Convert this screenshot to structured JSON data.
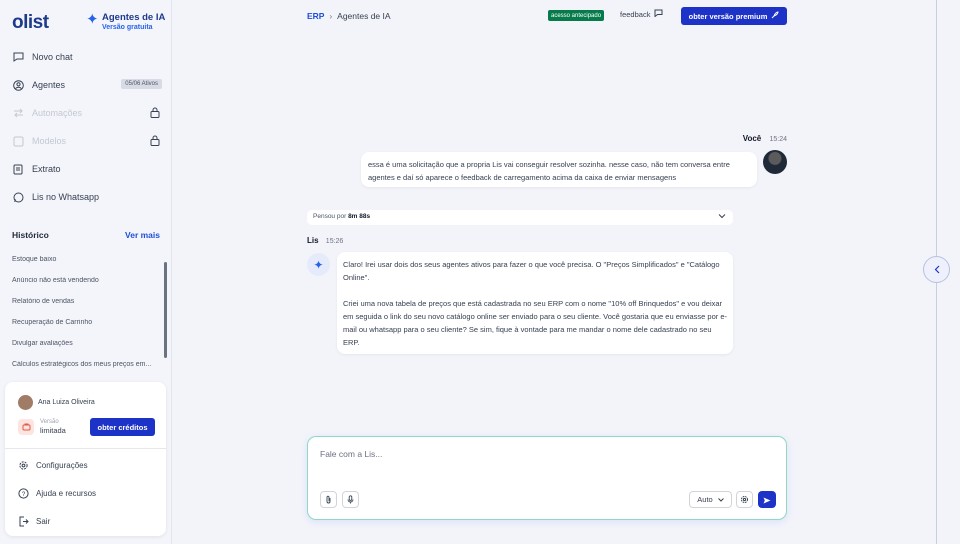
{
  "brand": {
    "logo": "olist",
    "agents_title": "Agentes de IA",
    "agents_subtitle": "Versão gratuita"
  },
  "nav": {
    "new_chat": "Novo chat",
    "agents": "Agentes",
    "agents_badge": "05/06 Ativos",
    "automations": "Automações",
    "models": "Modelos",
    "statement": "Extrato",
    "whatsapp": "Lis no Whatsapp"
  },
  "history": {
    "title": "Histórico",
    "see_more": "Ver mais",
    "items": [
      "Estoque baixo",
      "Anúncio não está vendendo",
      "Relatório de vendas",
      "Recuperação de Carrinho",
      "Divulgar avaliações",
      "Cálculos estratégicos dos meus preços em..."
    ]
  },
  "user_card": {
    "name": "Ana Luiza Oliveira",
    "version_label": "Versão",
    "version_value": "limitada",
    "credits_button": "obter créditos",
    "settings": "Configurações",
    "help": "Ajuda e recursos",
    "logout": "Sair"
  },
  "topbar": {
    "crumb_root": "ERP",
    "crumb_current": "Agentes de IA",
    "early_access": "acesso antecipado",
    "feedback": "feedback",
    "premium_button": "obter versão premium"
  },
  "messages": {
    "user_name": "Você",
    "user_time": "15:24",
    "user_text": "essa é uma solicitação que a propria Lis vai conseguir resolver sozinha. nesse caso, não tem conversa entre agentes e daí só aparece o feedback de carregamento acima da caixa de enviar mensagens",
    "thought_label": "Pensou por",
    "thought_time": "8m 88s",
    "lis_name": "Lis",
    "lis_time": "15:26",
    "lis_p1": "Claro! Irei usar dois dos seus agentes ativos para fazer o que você precisa. O \"Preços Simplificados\" e \"Catálogo Online\".",
    "lis_p2": "Criei uma nova tabela de preços que está cadastrada no seu ERP com o nome \"10% off Brinquedos\" e vou deixar em seguida o link do seu novo catálogo online ser enviado para o seu cliente. Você gostaria que eu enviasse por e-mail ou whatsapp para o seu cliente? Se sim, fique à vontade para me mandar o nome dele cadastrado no seu ERP."
  },
  "composer": {
    "placeholder": "Fale com a Lis...",
    "mode": "Auto"
  },
  "colors": {
    "primary": "#1d32c7",
    "accent_green": "#067a4a",
    "brand_blue": "#1e3a8a"
  }
}
